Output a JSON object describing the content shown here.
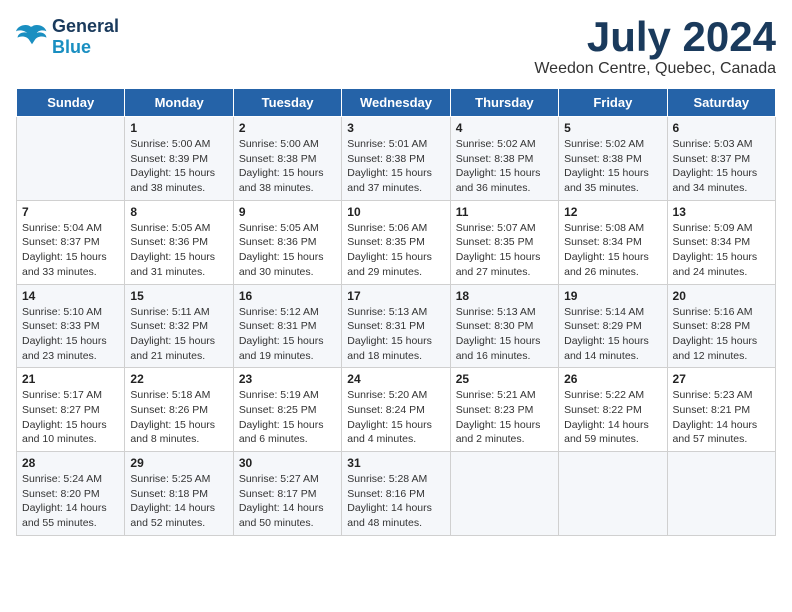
{
  "header": {
    "logo_line1": "General",
    "logo_line2": "Blue",
    "month_year": "July 2024",
    "location": "Weedon Centre, Quebec, Canada"
  },
  "weekdays": [
    "Sunday",
    "Monday",
    "Tuesday",
    "Wednesday",
    "Thursday",
    "Friday",
    "Saturday"
  ],
  "weeks": [
    [
      {
        "day": "",
        "info": ""
      },
      {
        "day": "1",
        "info": "Sunrise: 5:00 AM\nSunset: 8:39 PM\nDaylight: 15 hours\nand 38 minutes."
      },
      {
        "day": "2",
        "info": "Sunrise: 5:00 AM\nSunset: 8:38 PM\nDaylight: 15 hours\nand 38 minutes."
      },
      {
        "day": "3",
        "info": "Sunrise: 5:01 AM\nSunset: 8:38 PM\nDaylight: 15 hours\nand 37 minutes."
      },
      {
        "day": "4",
        "info": "Sunrise: 5:02 AM\nSunset: 8:38 PM\nDaylight: 15 hours\nand 36 minutes."
      },
      {
        "day": "5",
        "info": "Sunrise: 5:02 AM\nSunset: 8:38 PM\nDaylight: 15 hours\nand 35 minutes."
      },
      {
        "day": "6",
        "info": "Sunrise: 5:03 AM\nSunset: 8:37 PM\nDaylight: 15 hours\nand 34 minutes."
      }
    ],
    [
      {
        "day": "7",
        "info": "Sunrise: 5:04 AM\nSunset: 8:37 PM\nDaylight: 15 hours\nand 33 minutes."
      },
      {
        "day": "8",
        "info": "Sunrise: 5:05 AM\nSunset: 8:36 PM\nDaylight: 15 hours\nand 31 minutes."
      },
      {
        "day": "9",
        "info": "Sunrise: 5:05 AM\nSunset: 8:36 PM\nDaylight: 15 hours\nand 30 minutes."
      },
      {
        "day": "10",
        "info": "Sunrise: 5:06 AM\nSunset: 8:35 PM\nDaylight: 15 hours\nand 29 minutes."
      },
      {
        "day": "11",
        "info": "Sunrise: 5:07 AM\nSunset: 8:35 PM\nDaylight: 15 hours\nand 27 minutes."
      },
      {
        "day": "12",
        "info": "Sunrise: 5:08 AM\nSunset: 8:34 PM\nDaylight: 15 hours\nand 26 minutes."
      },
      {
        "day": "13",
        "info": "Sunrise: 5:09 AM\nSunset: 8:34 PM\nDaylight: 15 hours\nand 24 minutes."
      }
    ],
    [
      {
        "day": "14",
        "info": "Sunrise: 5:10 AM\nSunset: 8:33 PM\nDaylight: 15 hours\nand 23 minutes."
      },
      {
        "day": "15",
        "info": "Sunrise: 5:11 AM\nSunset: 8:32 PM\nDaylight: 15 hours\nand 21 minutes."
      },
      {
        "day": "16",
        "info": "Sunrise: 5:12 AM\nSunset: 8:31 PM\nDaylight: 15 hours\nand 19 minutes."
      },
      {
        "day": "17",
        "info": "Sunrise: 5:13 AM\nSunset: 8:31 PM\nDaylight: 15 hours\nand 18 minutes."
      },
      {
        "day": "18",
        "info": "Sunrise: 5:13 AM\nSunset: 8:30 PM\nDaylight: 15 hours\nand 16 minutes."
      },
      {
        "day": "19",
        "info": "Sunrise: 5:14 AM\nSunset: 8:29 PM\nDaylight: 15 hours\nand 14 minutes."
      },
      {
        "day": "20",
        "info": "Sunrise: 5:16 AM\nSunset: 8:28 PM\nDaylight: 15 hours\nand 12 minutes."
      }
    ],
    [
      {
        "day": "21",
        "info": "Sunrise: 5:17 AM\nSunset: 8:27 PM\nDaylight: 15 hours\nand 10 minutes."
      },
      {
        "day": "22",
        "info": "Sunrise: 5:18 AM\nSunset: 8:26 PM\nDaylight: 15 hours\nand 8 minutes."
      },
      {
        "day": "23",
        "info": "Sunrise: 5:19 AM\nSunset: 8:25 PM\nDaylight: 15 hours\nand 6 minutes."
      },
      {
        "day": "24",
        "info": "Sunrise: 5:20 AM\nSunset: 8:24 PM\nDaylight: 15 hours\nand 4 minutes."
      },
      {
        "day": "25",
        "info": "Sunrise: 5:21 AM\nSunset: 8:23 PM\nDaylight: 15 hours\nand 2 minutes."
      },
      {
        "day": "26",
        "info": "Sunrise: 5:22 AM\nSunset: 8:22 PM\nDaylight: 14 hours\nand 59 minutes."
      },
      {
        "day": "27",
        "info": "Sunrise: 5:23 AM\nSunset: 8:21 PM\nDaylight: 14 hours\nand 57 minutes."
      }
    ],
    [
      {
        "day": "28",
        "info": "Sunrise: 5:24 AM\nSunset: 8:20 PM\nDaylight: 14 hours\nand 55 minutes."
      },
      {
        "day": "29",
        "info": "Sunrise: 5:25 AM\nSunset: 8:18 PM\nDaylight: 14 hours\nand 52 minutes."
      },
      {
        "day": "30",
        "info": "Sunrise: 5:27 AM\nSunset: 8:17 PM\nDaylight: 14 hours\nand 50 minutes."
      },
      {
        "day": "31",
        "info": "Sunrise: 5:28 AM\nSunset: 8:16 PM\nDaylight: 14 hours\nand 48 minutes."
      },
      {
        "day": "",
        "info": ""
      },
      {
        "day": "",
        "info": ""
      },
      {
        "day": "",
        "info": ""
      }
    ]
  ]
}
